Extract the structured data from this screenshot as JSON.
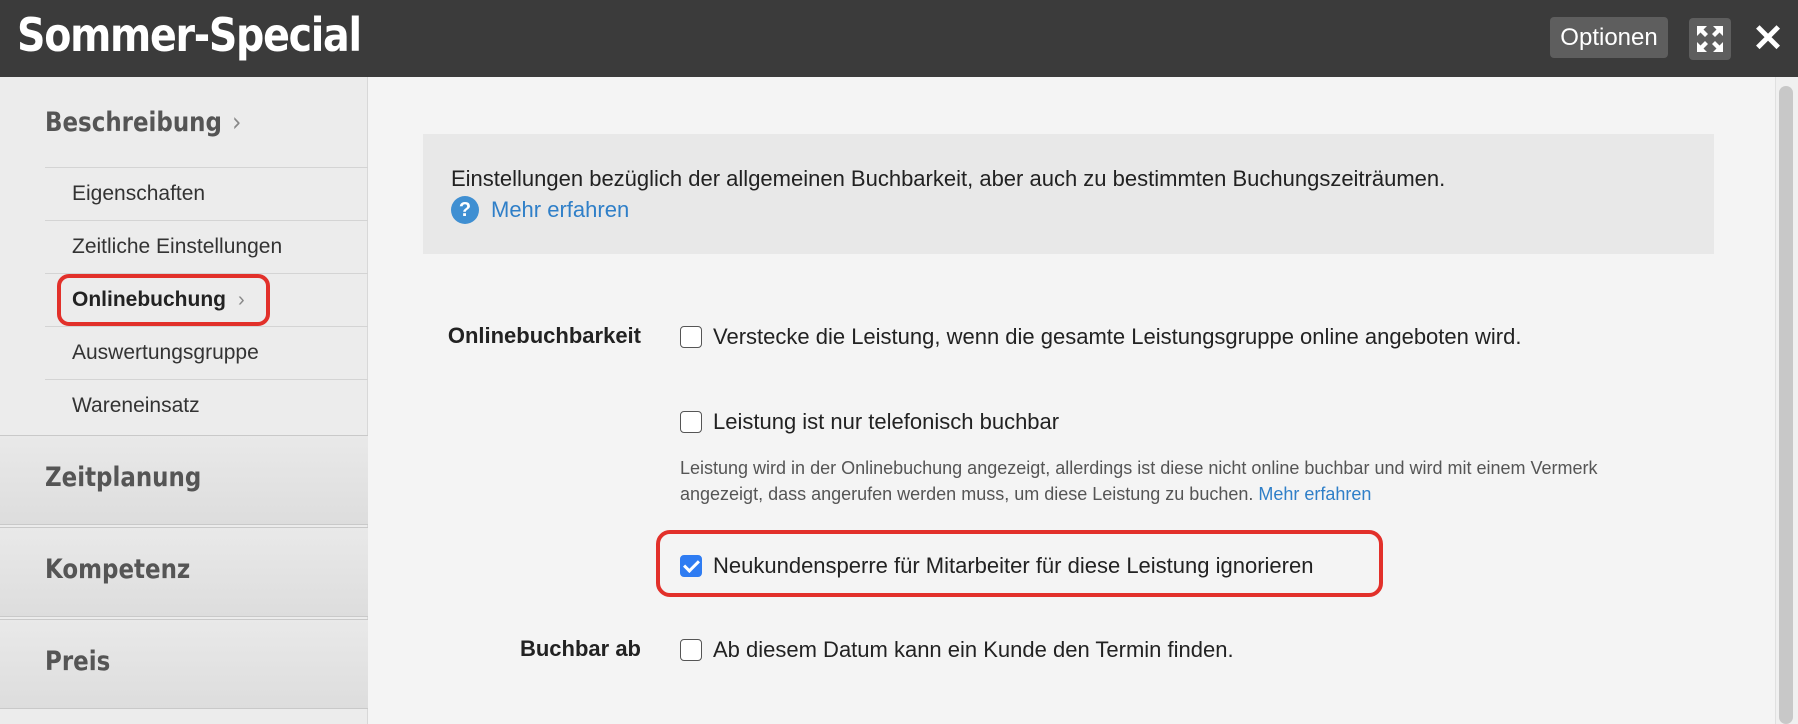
{
  "header": {
    "title": "Sommer-Special",
    "options_label": "Optionen",
    "expand_icon": "expand-icon",
    "close_icon": "close-icon",
    "close_glyph": "✕"
  },
  "sidebar": {
    "section_title": "Beschreibung",
    "chevron": "›",
    "items": [
      {
        "label": "Eigenschaften"
      },
      {
        "label": "Zeitliche Einstellungen"
      },
      {
        "label": "Onlinebuchung",
        "active": true
      },
      {
        "label": "Auswertungsgruppe"
      },
      {
        "label": "Wareneinsatz"
      }
    ],
    "groups": [
      {
        "label": "Zeitplanung"
      },
      {
        "label": "Kompetenz"
      },
      {
        "label": "Preis"
      }
    ]
  },
  "main": {
    "info": {
      "text": "Einstellungen bezüglich der allgemeinen Buchbarkeit, aber auch zu bestimmten Buchungszeiträumen.",
      "help_glyph": "?",
      "link": "Mehr erfahren"
    },
    "online": {
      "label": "Onlinebuchbarkeit",
      "options": [
        {
          "label": "Verstecke die Leistung, wenn die gesamte Leistungsgruppe online angeboten wird.",
          "checked": false
        },
        {
          "label": "Leistung ist nur telefonisch buchbar",
          "checked": false
        },
        {
          "label": "Neukundensperre für Mitarbeiter für diese Leistung ignorieren",
          "checked": true
        }
      ],
      "description": "Leistung wird in der Onlinebuchung angezeigt, allerdings ist diese nicht online buchbar und wird mit einem Vermerk angezeigt, dass angerufen werden muss, um diese Leistung zu buchen.",
      "description_link": "Mehr erfahren"
    },
    "bookable": {
      "label": "Buchbar ab",
      "option": {
        "label": "Ab diesem Datum kann ein Kunde den Termin finden.",
        "checked": false
      }
    }
  },
  "colors": {
    "header_bg": "#3b3b3b",
    "accent": "#2f7cf2",
    "highlight": "#e2302a",
    "link": "#2f7fc8"
  }
}
